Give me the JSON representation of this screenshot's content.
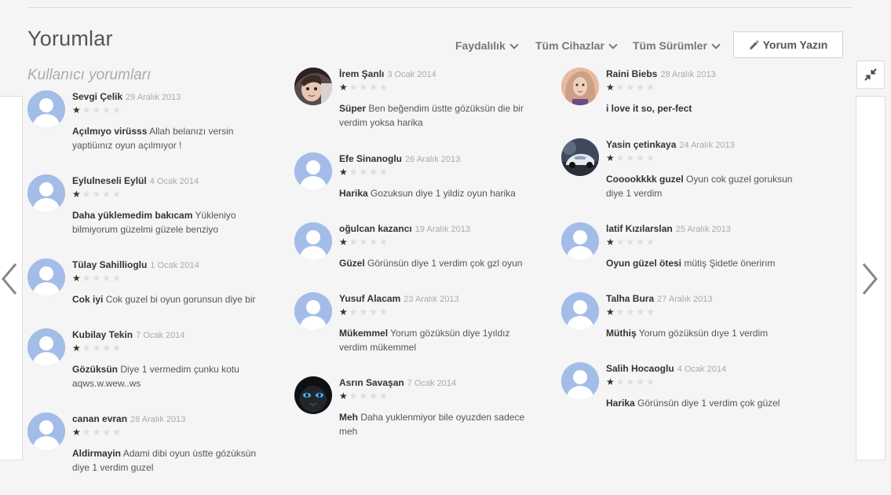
{
  "section": {
    "title": "Yorumlar",
    "subtitle": "Kullanıcı yorumları"
  },
  "filters": {
    "helpfulness": "Faydalılık",
    "devices": "Tüm Cihazlar",
    "versions": "Tüm Sürümler",
    "write_review": "Yorum Yazın"
  },
  "reviews": [
    {
      "author": "Sevgi Çelik",
      "date": "29 Aralık 2013",
      "rating": 1,
      "title": "Açılmıyo virüsss",
      "text": "Allah belanızı versin yaptiüınız oyun açılmıyor !",
      "avatar": "default"
    },
    {
      "author": "Eylulneseli Eylül",
      "date": "4 Ocak 2014",
      "rating": 1,
      "title": "Daha yüklemedim bakıcam",
      "text": "Yükleniyo bilmiyorum güzelmi güzele benziyo",
      "avatar": "default"
    },
    {
      "author": "Tülay Sahillioglu",
      "date": "1 Ocak 2014",
      "rating": 1,
      "title": "Cok iyi",
      "text": "Cok guzel bi oyun gorunsun diye bir",
      "avatar": "default"
    },
    {
      "author": "Kubilay Tekin",
      "date": "7 Ocak 2014",
      "rating": 1,
      "title": "Gözüksün",
      "text": "Diye 1 vermedim çunku kotu aqws.w.wew..ws",
      "avatar": "default"
    },
    {
      "author": "canan evran",
      "date": "28 Aralık 2013",
      "rating": 1,
      "title": "Aldirmayin",
      "text": "Adami dibi oyun ùstte gózùksùn diye 1 verdim guzel",
      "avatar": "default"
    },
    {
      "author": "İrem Şanlı",
      "date": "3 Ocak 2014",
      "rating": 1,
      "title": "Süper",
      "text": "Ben beğendim üstte gözüksün die bir verdim yoksa harika",
      "avatar": "child-photo"
    },
    {
      "author": "Efe Sinanoglu",
      "date": "26 Aralık 2013",
      "rating": 1,
      "title": "Harika",
      "text": "Gozuksun diye 1 yildiz oyun harika",
      "avatar": "default"
    },
    {
      "author": "oğulcan kazancı",
      "date": "19 Aralık 2013",
      "rating": 1,
      "title": "Güzel",
      "text": "Görünsün diye 1 verdim çok gzl oyun",
      "avatar": "default"
    },
    {
      "author": "Yusuf Alacam",
      "date": "23 Aralık 2013",
      "rating": 1,
      "title": "Mükemmel",
      "text": "Yorum gözüksün diye 1yıldız verdim mükemmel",
      "avatar": "default"
    },
    {
      "author": "Asrın Savaşan",
      "date": "7 Ocak 2014",
      "rating": 1,
      "title": "Meh",
      "text": "Daha yuklenmiyor bile oyuzden sadece meh",
      "avatar": "dark-cat-photo"
    },
    {
      "author": "Raini Biebs",
      "date": "28 Aralık 2013",
      "rating": 1,
      "title": "i love it so, per-fect",
      "text": "",
      "avatar": "girl-photo"
    },
    {
      "author": "Yasin çetinkaya",
      "date": "24 Aralık 2013",
      "rating": 1,
      "title": "Cooookkkk guzel",
      "text": "Oyun cok guzel goruksun diye 1 verdim",
      "avatar": "car-photo"
    },
    {
      "author": "latif Kızılarslan",
      "date": "25 Aralık 2013",
      "rating": 1,
      "title": "Oyun güzel ötesi",
      "text": "mütiş Şidetle önerirım",
      "avatar": "default"
    },
    {
      "author": "Talha Bura",
      "date": "27 Aralık 2013",
      "rating": 1,
      "title": "Müthiş",
      "text": "Yorum gözüksün dıye 1 verdim",
      "avatar": "default"
    },
    {
      "author": "Salih Hocaoglu",
      "date": "4 Ocak 2014",
      "rating": 1,
      "title": "Harika",
      "text": "Görünsün diye 1 verdim çok güzel",
      "avatar": "default"
    }
  ],
  "colors": {
    "avatar_default": "#a3bde8",
    "star_on": "#333333",
    "star_off": "#dddddd"
  },
  "icons": {
    "prev": "chevron-left-icon",
    "next": "chevron-right-icon",
    "collapse": "collapse-icon",
    "pencil": "pencil-icon"
  }
}
